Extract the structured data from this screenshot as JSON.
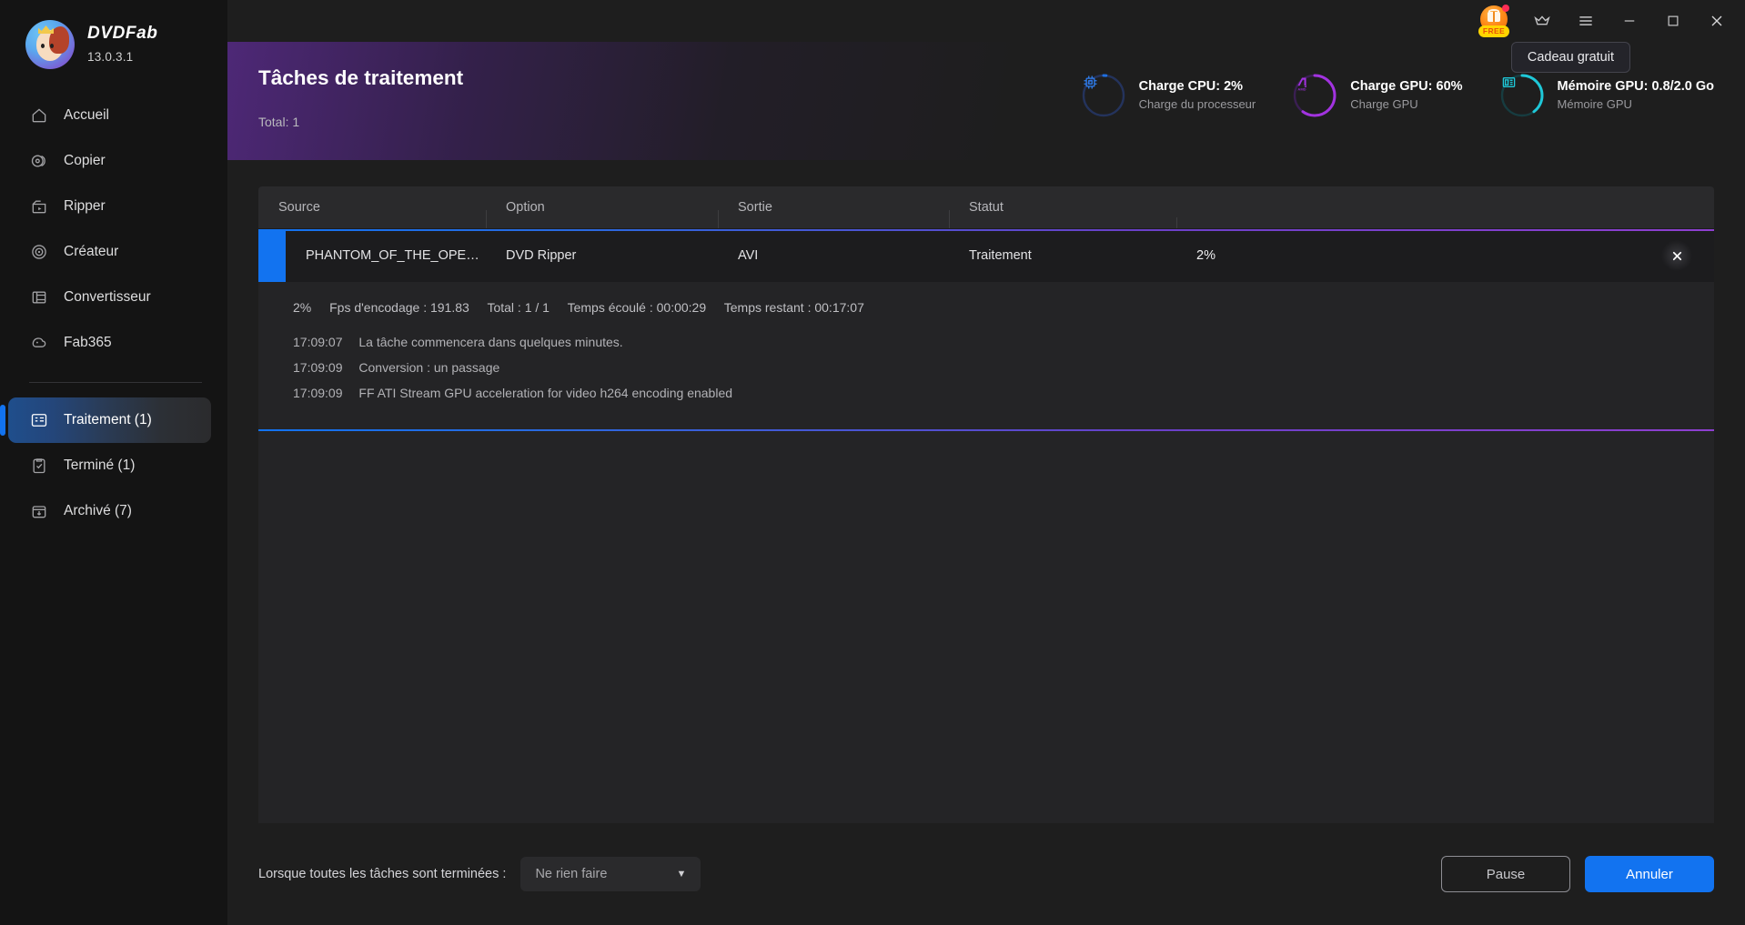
{
  "brand": {
    "name": "DVDFab",
    "version": "13.0.3.1",
    "logo_icon": "dvdfab-mascot-logo"
  },
  "sidebar": {
    "items": [
      {
        "label": "Accueil",
        "icon": "home-icon",
        "active": false
      },
      {
        "label": "Copier",
        "icon": "copy-disc-icon",
        "active": false
      },
      {
        "label": "Ripper",
        "icon": "ripper-icon",
        "active": false
      },
      {
        "label": "Créateur",
        "icon": "disc-creator-icon",
        "active": false
      },
      {
        "label": "Convertisseur",
        "icon": "film-converter-icon",
        "active": false
      },
      {
        "label": "Fab365",
        "icon": "fab365-icon",
        "active": false
      }
    ],
    "queue_items": [
      {
        "label": "Traitement (1)",
        "icon": "task-list-icon",
        "active": true
      },
      {
        "label": "Terminé (1)",
        "icon": "clipboard-check-icon",
        "active": false
      },
      {
        "label": "Archivé (7)",
        "icon": "archive-box-icon",
        "active": false
      }
    ]
  },
  "titlebar": {
    "gift_label": "FREE",
    "gift_icon": "gift-free-icon",
    "tooltip": "Cadeau gratuit",
    "crown_icon": "crown-icon",
    "menu_icon": "hamburger-menu-icon",
    "minimize_icon": "minimize-icon",
    "maximize_icon": "maximize-icon",
    "close_icon": "close-icon"
  },
  "header": {
    "title": "Tâches de traitement",
    "total": "Total: 1",
    "stats": [
      {
        "title": "Charge CPU: 2%",
        "subtitle": "Charge du processeur",
        "icon": "cpu-chip-icon",
        "color": "#1f6fe0",
        "percent": 2
      },
      {
        "title": "Charge GPU: 60%",
        "subtitle": "Charge GPU",
        "icon": "amd-gpu-icon",
        "color": "#a233e0",
        "percent": 60
      },
      {
        "title": "Mémoire GPU: 0.8/2.0 Go",
        "subtitle": "Mémoire GPU",
        "icon": "memory-module-icon",
        "color": "#1fc8d8",
        "percent": 40
      }
    ]
  },
  "table": {
    "columns": [
      "Source",
      "Option",
      "Sortie",
      "Statut",
      ""
    ],
    "row": {
      "source": "PHANTOM_OF_THE_OPE…",
      "option": "DVD Ripper",
      "output": "AVI",
      "status": "Traitement",
      "progress": "2%",
      "close_icon": "close-task-icon"
    },
    "detail": {
      "metrics": [
        "2%",
        "Fps d'encodage : 191.83",
        "Total : 1 / 1",
        "Temps écoulé : 00:00:29",
        "Temps restant : 00:17:07"
      ],
      "logs": [
        {
          "time": "17:09:07",
          "message": "La tâche commencera dans quelques minutes."
        },
        {
          "time": "17:09:09",
          "message": "Conversion : un passage"
        },
        {
          "time": "17:09:09",
          "message": "FF ATI Stream GPU acceleration for video h264 encoding enabled"
        }
      ]
    }
  },
  "footer": {
    "label": "Lorsque toutes les tâches sont terminées :",
    "select_value": "Ne rien faire",
    "caret_icon": "chevron-down-icon",
    "pause_label": "Pause",
    "cancel_label": "Annuler"
  },
  "colors": {
    "accent_blue": "#1273f0",
    "accent_purple": "#8e3fd0",
    "sidebar_bg": "#141414",
    "main_bg": "#1e1e1e"
  }
}
